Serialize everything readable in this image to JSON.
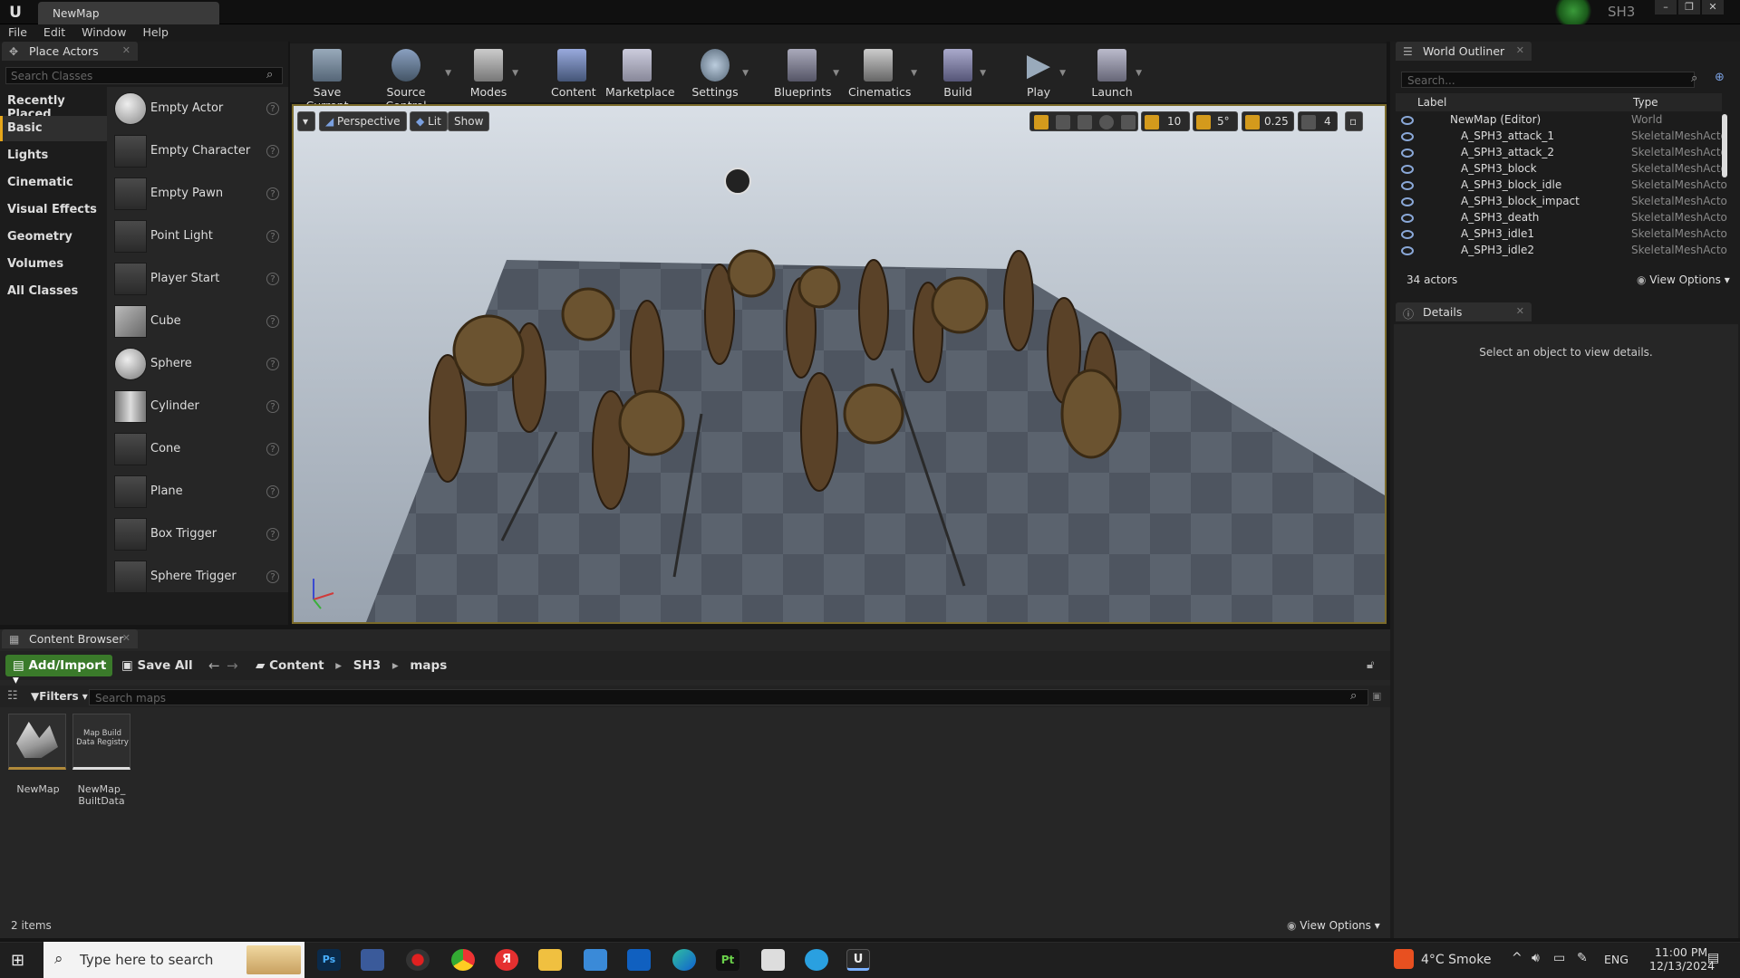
{
  "window": {
    "doc_tab": "NewMap",
    "project": "SH3",
    "controls": [
      "–",
      "❐",
      "✕"
    ]
  },
  "menu": [
    "File",
    "Edit",
    "Window",
    "Help"
  ],
  "place_actors": {
    "tab": "Place Actors",
    "search_placeholder": "Search Classes",
    "categories": [
      "Recently Placed",
      "Basic",
      "Lights",
      "Cinematic",
      "Visual Effects",
      "Geometry",
      "Volumes",
      "All Classes"
    ],
    "selected_category": "Basic",
    "items": [
      "Empty Actor",
      "Empty Character",
      "Empty Pawn",
      "Point Light",
      "Player Start",
      "Cube",
      "Sphere",
      "Cylinder",
      "Cone",
      "Plane",
      "Box Trigger",
      "Sphere Trigger"
    ]
  },
  "toolbar": {
    "buttons": [
      "Save Current",
      "Source Control",
      "Modes",
      "Content",
      "Marketplace",
      "Settings",
      "Blueprints",
      "Cinematics",
      "Build",
      "Play",
      "Launch"
    ]
  },
  "viewport": {
    "perspective": "Perspective",
    "lit": "Lit",
    "show": "Show",
    "grid_snap": "10",
    "rot_snap": "5°",
    "scale_snap": "0.25",
    "camera_speed": "4"
  },
  "outliner": {
    "tab": "World Outliner",
    "search_placeholder": "Search...",
    "col_label": "Label",
    "col_type": "Type",
    "rows": [
      {
        "label": "NewMap (Editor)",
        "type": "World"
      },
      {
        "label": "A_SPH3_attack_1",
        "type": "SkeletalMeshActo"
      },
      {
        "label": "A_SPH3_attack_2",
        "type": "SkeletalMeshActo"
      },
      {
        "label": "A_SPH3_block",
        "type": "SkeletalMeshActo"
      },
      {
        "label": "A_SPH3_block_idle",
        "type": "SkeletalMeshActo"
      },
      {
        "label": "A_SPH3_block_impact",
        "type": "SkeletalMeshActo"
      },
      {
        "label": "A_SPH3_death",
        "type": "SkeletalMeshActo"
      },
      {
        "label": "A_SPH3_idle1",
        "type": "SkeletalMeshActo"
      },
      {
        "label": "A_SPH3_idle2",
        "type": "SkeletalMeshActo"
      }
    ],
    "count": "34 actors",
    "view_options": "View Options"
  },
  "details": {
    "tab": "Details",
    "empty_msg": "Select an object to view details."
  },
  "content_browser": {
    "tab": "Content Browser",
    "add_import": "Add/Import",
    "save_all": "Save All",
    "path": [
      "Content",
      "SH3",
      "maps"
    ],
    "filters": "Filters",
    "search_placeholder": "Search maps",
    "assets": [
      {
        "name": "NewMap",
        "thumb": ""
      },
      {
        "name": "NewMap_\nBuiltData",
        "thumb": "Map Build Data Registry"
      }
    ],
    "item_count": "2 items",
    "view_options": "View Options"
  },
  "taskbar": {
    "search_placeholder": "Type here to search",
    "weather": "4°C  Smoke",
    "lang": "ENG",
    "time": "11:00 PM",
    "date": "12/13/2024"
  }
}
